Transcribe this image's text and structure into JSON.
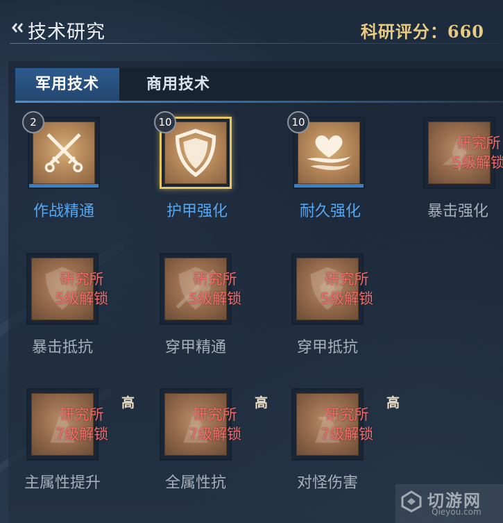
{
  "header": {
    "title": "技术研究",
    "score_label": "科研评分：",
    "score_value": "660"
  },
  "tabs": [
    {
      "label": "军用技术",
      "active": true
    },
    {
      "label": "商用技术",
      "active": false
    }
  ],
  "techs": [
    {
      "name": "作战精通",
      "level": "2",
      "locked": false,
      "icon": "crossed-swords-icon"
    },
    {
      "name": "护甲强化",
      "level": "10",
      "locked": false,
      "selected": true,
      "icon": "shield-icon"
    },
    {
      "name": "耐久强化",
      "level": "10",
      "locked": false,
      "icon": "heart-icon"
    },
    {
      "name": "暴击强化",
      "locked": true,
      "lock_line1": "研究所",
      "lock_line2": "5级解锁",
      "icon": "critical-strike-icon"
    },
    {
      "name": "暴击抵抗",
      "locked": true,
      "lock_line1": "研究所",
      "lock_line2": "5级解锁",
      "icon": "critical-resist-icon"
    },
    {
      "name": "穿甲精通",
      "locked": true,
      "lock_line1": "研究所",
      "lock_line2": "5级解锁",
      "icon": "armor-pierce-icon"
    },
    {
      "name": "穿甲抵抗",
      "locked": true,
      "lock_line1": "研究所",
      "lock_line2": "5级解锁",
      "icon": "pierce-resist-icon"
    },
    {
      "name": "主属性提升",
      "locked": true,
      "tag": "高",
      "lock_line1": "研究所",
      "lock_line2": "7级解锁",
      "icon": "main-attribute-icon"
    },
    {
      "name": "全属性抗",
      "locked": true,
      "tag": "高",
      "lock_line1": "研究所",
      "lock_line2": "7级解锁",
      "icon": "all-resist-icon"
    },
    {
      "name": "对怪伤害",
      "locked": true,
      "tag": "高",
      "lock_line1": "研究所",
      "lock_line2": "7级解锁",
      "icon": "monster-damage-icon"
    }
  ],
  "watermark": {
    "text_cn": "切游网",
    "text_en": "Qieyou.com"
  },
  "colors": {
    "unlocked_label": "#56a7f0",
    "locked_label": "#a7b0ba",
    "lock_text": "#f06a6a",
    "score": "#e9cc83",
    "selected_border": "#e8c65a"
  }
}
